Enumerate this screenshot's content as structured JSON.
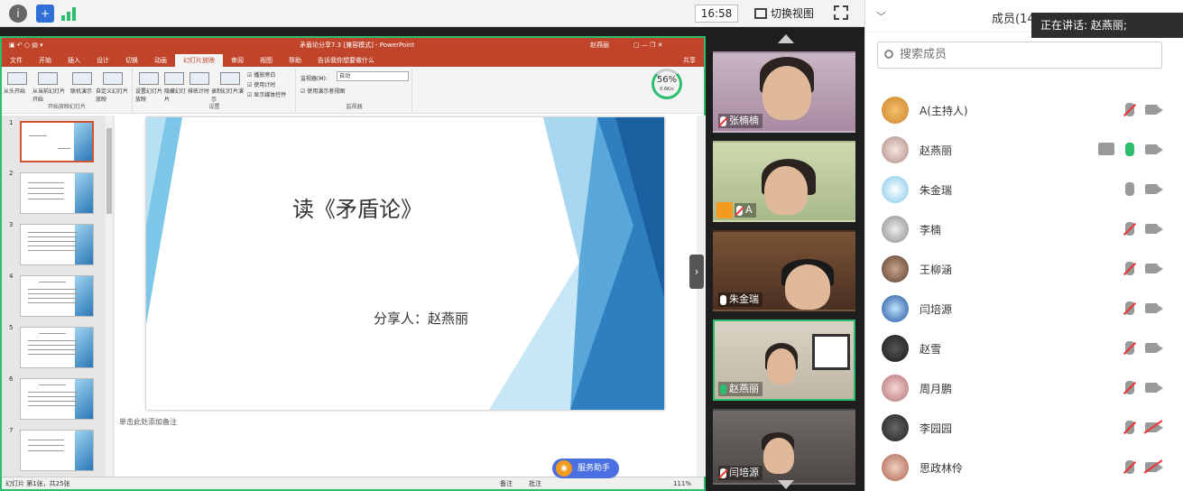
{
  "topbar": {
    "clock": "16:58",
    "switch_view_label": "切换视图"
  },
  "ppt": {
    "window_title": "矛盾论分享7.3 [兼容模式] - PowerPoint",
    "user": "赵燕丽",
    "share_label": "共享",
    "tabs": [
      "文件",
      "开始",
      "插入",
      "设计",
      "切换",
      "动画",
      "幻灯片放映",
      "审阅",
      "视图",
      "帮助",
      "告诉我你想要做什么"
    ],
    "active_tab": "幻灯片放映",
    "ribbon": {
      "group1_label": "开始放映幻灯片",
      "group2_label": "设置",
      "group3_label": "监视器",
      "buttons": [
        "从头开始",
        "从当前幻灯片开始",
        "联机演示",
        "自定义幻灯片放映",
        "设置幻灯片放映",
        "隐藏幻灯片",
        "排练计时",
        "录制幻灯片演示"
      ],
      "checks": [
        "播放旁白",
        "使用计时",
        "显示媒体控件"
      ],
      "monitor_label": "监视器(M):",
      "monitor_value": "自动",
      "presenter_view": "使用演示者视图"
    },
    "network": {
      "percent": "56%",
      "rate": "0.6K/s"
    },
    "thumb_numbers": [
      "1",
      "2",
      "3",
      "4",
      "5",
      "6",
      "7"
    ],
    "slide": {
      "title": "读《矛盾论》",
      "presenter": "分享人：赵燕丽"
    },
    "notes_placeholder": "单击此处添加备注",
    "status": {
      "slide_info": "幻灯片 第1张，共25张",
      "notes": "备注",
      "comments": "批注",
      "zoom": "111%"
    }
  },
  "assistant_label": "服务助手",
  "videos": [
    {
      "name": "张楠楠",
      "mic": "muted"
    },
    {
      "name": "A",
      "mic": "muted",
      "host": true
    },
    {
      "name": "朱金瑞",
      "mic": "on"
    },
    {
      "name": "赵燕丽",
      "mic": "speaking",
      "active": true
    },
    {
      "name": "闫培源",
      "mic": "muted"
    }
  ],
  "members": {
    "header": "成员(14",
    "speaking_banner": "正在讲话: 赵燕丽;",
    "search_placeholder": "搜索成员",
    "list": [
      {
        "name": "A(主持人)",
        "mic": "muted",
        "cam": "on"
      },
      {
        "name": "赵燕丽",
        "mic": "on",
        "cam": "on",
        "sharing": true
      },
      {
        "name": "朱金瑞",
        "mic": "idle",
        "cam": "on"
      },
      {
        "name": "李楠",
        "mic": "muted",
        "cam": "on"
      },
      {
        "name": "王柳涵",
        "mic": "muted",
        "cam": "on"
      },
      {
        "name": "闫培源",
        "mic": "muted",
        "cam": "on"
      },
      {
        "name": "赵雪",
        "mic": "muted",
        "cam": "on"
      },
      {
        "name": "周月鹏",
        "mic": "muted",
        "cam": "on"
      },
      {
        "name": "李园园",
        "mic": "muted",
        "cam": "off"
      },
      {
        "name": "思政林伶",
        "mic": "muted",
        "cam": "off"
      }
    ]
  }
}
